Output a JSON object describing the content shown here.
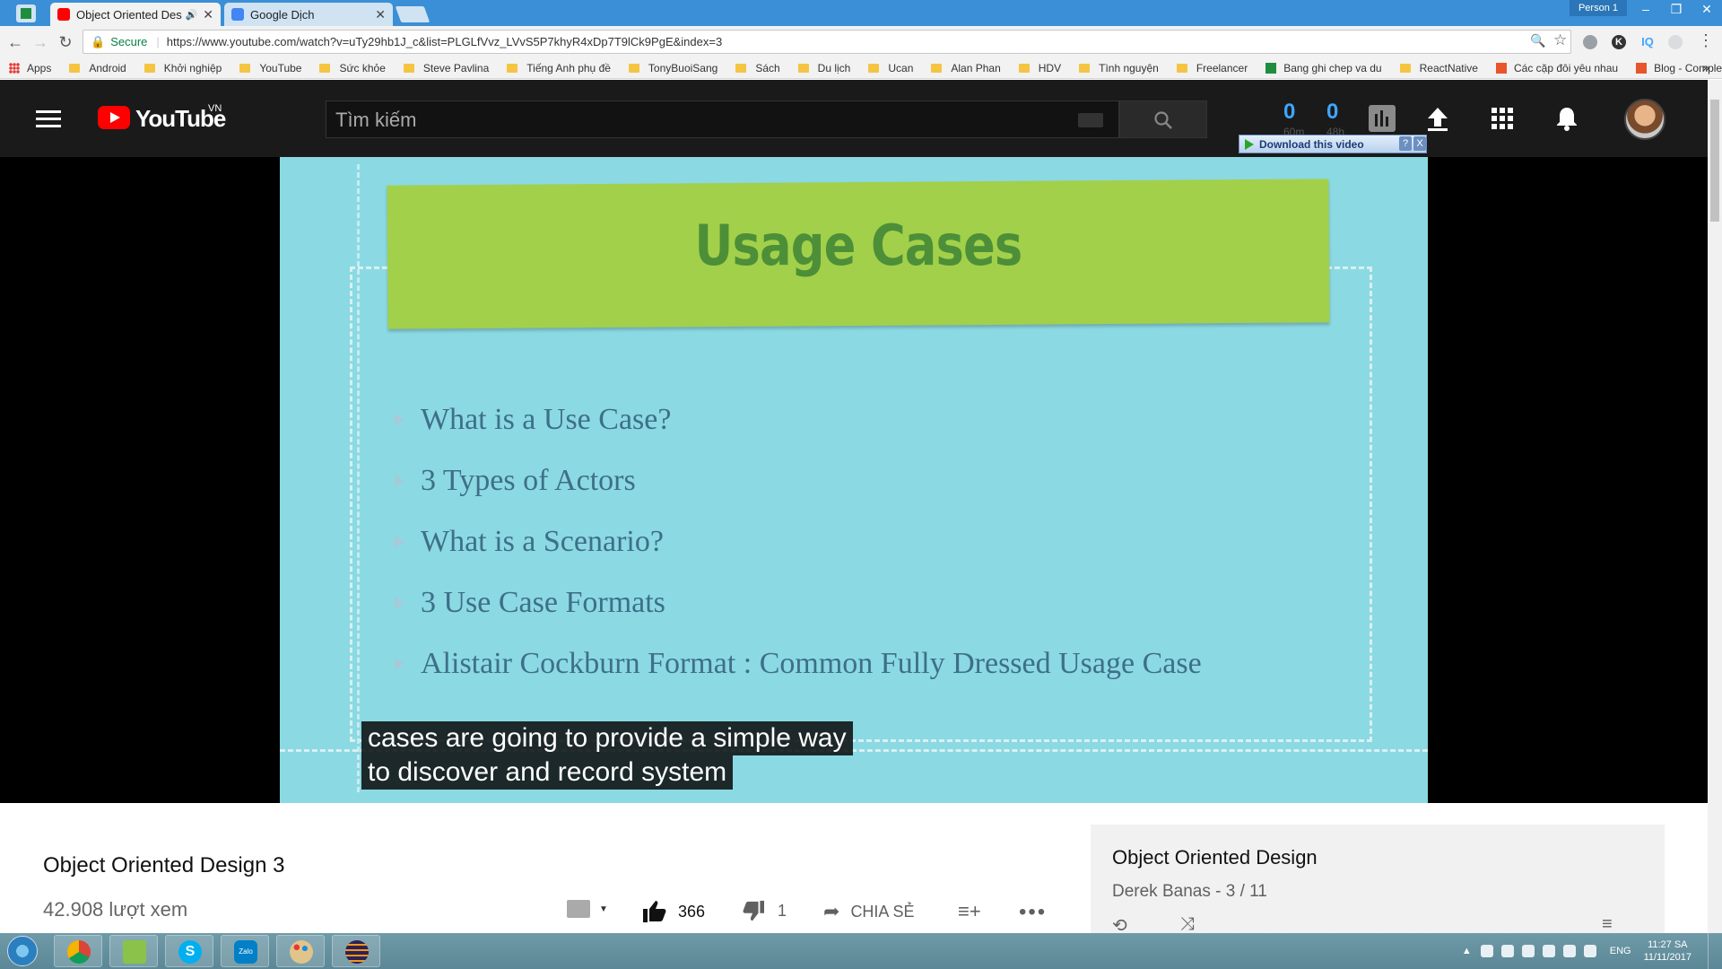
{
  "browser": {
    "tabs": [
      {
        "title": "Object Oriented Desig",
        "favicon_color": "#ff0000",
        "active": true
      },
      {
        "title": "Google Dịch",
        "favicon_color": "#4285f4",
        "active": false
      }
    ],
    "profile": "Person 1",
    "window_controls": [
      "–",
      "❐",
      "✕"
    ],
    "secure_label": "Secure",
    "url": "https://www.youtube.com/watch?v=uTy29hb1J_c&list=PLGLfVvz_LVvS5P7khyR4xDp7T9lCk9PgE&index=3",
    "bookmarks": [
      {
        "label": "Apps",
        "kind": "apps"
      },
      {
        "label": "Android",
        "kind": "folder"
      },
      {
        "label": "Khởi nghiệp",
        "kind": "folder"
      },
      {
        "label": "YouTube",
        "kind": "folder"
      },
      {
        "label": "Sức khỏe",
        "kind": "folder"
      },
      {
        "label": "Steve Pavlina",
        "kind": "folder"
      },
      {
        "label": "Tiếng Anh phụ đề",
        "kind": "folder"
      },
      {
        "label": "TonyBuoiSang",
        "kind": "folder"
      },
      {
        "label": "Sách",
        "kind": "folder"
      },
      {
        "label": "Du lịch",
        "kind": "folder"
      },
      {
        "label": "Ucan",
        "kind": "folder"
      },
      {
        "label": "Alan Phan",
        "kind": "folder"
      },
      {
        "label": "HDV",
        "kind": "folder"
      },
      {
        "label": "Tình nguyện",
        "kind": "folder"
      },
      {
        "label": "Freelancer",
        "kind": "folder"
      },
      {
        "label": "Bang ghi chep va du",
        "kind": "sheet"
      },
      {
        "label": "ReactNative",
        "kind": "folder"
      },
      {
        "label": "Các cặp đôi yêu nhau",
        "kind": "site"
      },
      {
        "label": "Blog - CompleteDigit",
        "kind": "site"
      }
    ],
    "extensions": [
      "zoom-icon",
      "star-icon",
      "ext-gray-icon",
      "ext-k-icon",
      "IQ",
      "ext-circle-icon",
      "menu-icon"
    ]
  },
  "youtube": {
    "logo_text": "YouTube",
    "region": "VN",
    "search_placeholder": "Tìm kiếm",
    "stats": [
      {
        "value": "0",
        "sub": "60m"
      },
      {
        "value": "0",
        "sub": "48h"
      }
    ],
    "download_bar": {
      "label": "Download this video",
      "help": "?",
      "close": "X"
    },
    "slide": {
      "title": "Usage Cases",
      "bullets": [
        "What is a Use Case?",
        "3 Types of Actors",
        "What is a Scenario?",
        "3 Use Case Formats",
        "Alistair Cockburn Format : Common Fully Dressed Usage Case"
      ]
    },
    "captions": [
      "cases are going to provide a simple way",
      "to discover and record system"
    ],
    "video_title": "Object Oriented Design 3",
    "views": "42.908 lượt xem",
    "likes": "366",
    "dislikes": "1",
    "share_label": "CHIA SẺ",
    "playlist": {
      "title": "Object Oriented Design",
      "subtitle": "Derek Banas - 3 / 11"
    }
  },
  "taskbar": {
    "apps": [
      {
        "name": "start-orb",
        "color": "#2a7fbf"
      },
      {
        "name": "chrome",
        "color": "#db4437"
      },
      {
        "name": "notepad",
        "color": "#8bc34a"
      },
      {
        "name": "skype",
        "color": "#00aff0"
      },
      {
        "name": "zalo",
        "color": "#0180c7"
      },
      {
        "name": "paint",
        "color": "#e0a84a"
      },
      {
        "name": "eclipse",
        "color": "#2c2255"
      }
    ],
    "zalo_label": "Zalo",
    "language": "ENG",
    "time": "11:27 SA",
    "date": "11/11/2017"
  }
}
